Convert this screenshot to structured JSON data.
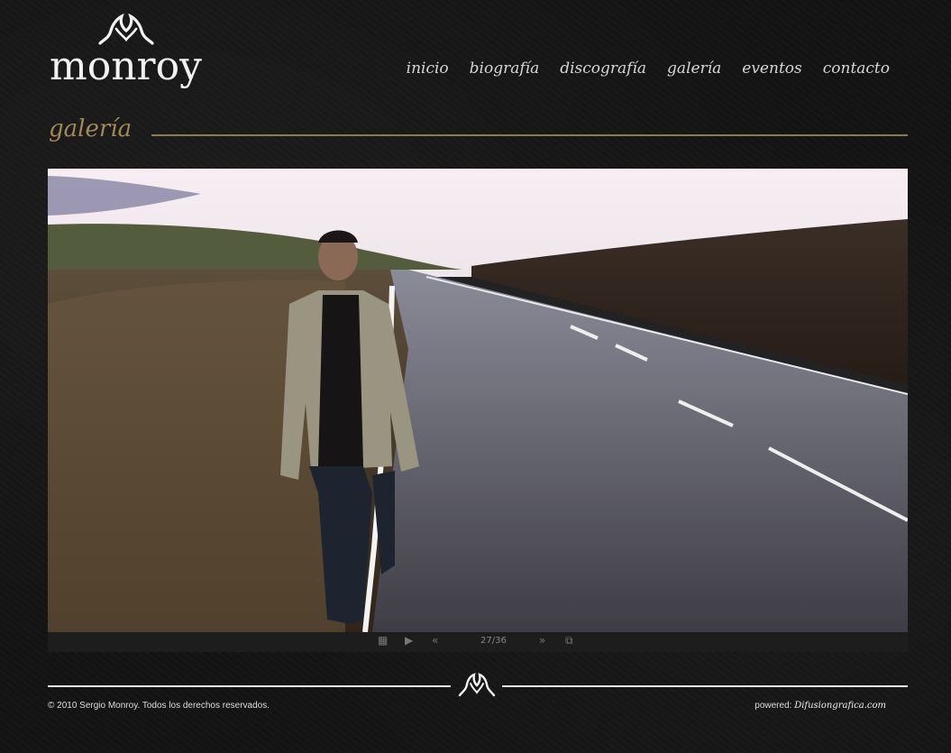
{
  "brand": {
    "name": "monroy",
    "icon": "m-flourish-icon"
  },
  "nav": {
    "items": [
      {
        "label": "inicio"
      },
      {
        "label": "biografía"
      },
      {
        "label": "discografía"
      },
      {
        "label": "galería"
      },
      {
        "label": "eventos"
      },
      {
        "label": "contacto"
      }
    ]
  },
  "page": {
    "title": "galería"
  },
  "gallery": {
    "counter": "27/36",
    "controls": {
      "grid_icon": "grid-icon",
      "play_icon": "play-icon",
      "prev_icon": "double-chevron-left-icon",
      "next_icon": "double-chevron-right-icon",
      "popout_icon": "external-window-icon"
    }
  },
  "footer": {
    "copyright": "© 2010 Sergio Monroy. Todos los derechos reservados.",
    "powered_label": "powered:",
    "powered_link": "Difusiongrafica.com"
  },
  "colors": {
    "accent": "#a08a55",
    "background": "#131313"
  }
}
